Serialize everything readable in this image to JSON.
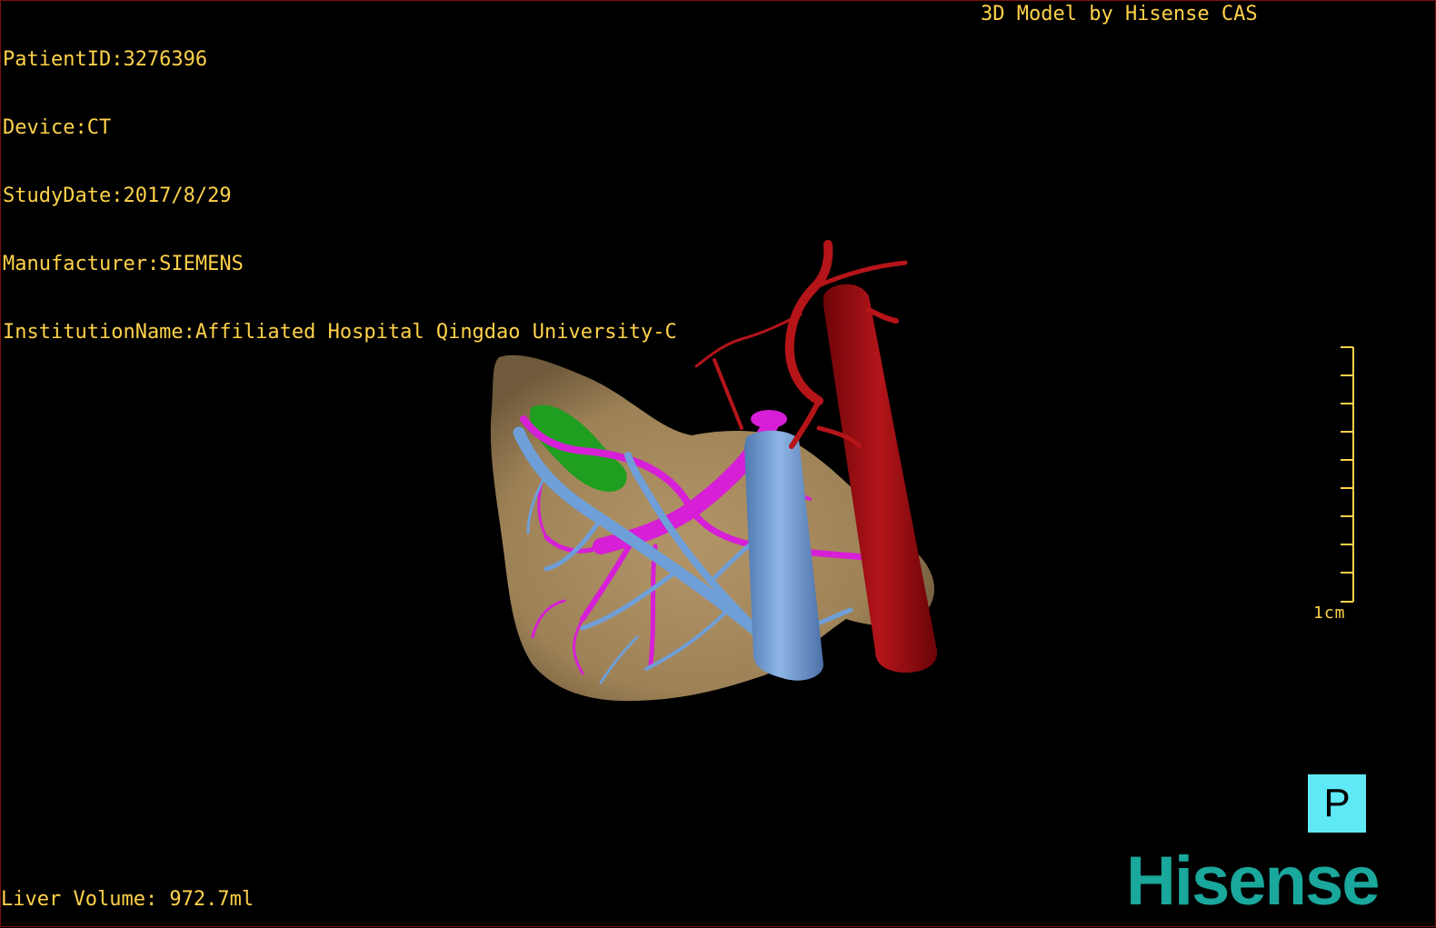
{
  "header": {
    "patient_id": "PatientID:3276396",
    "device": "Device:CT",
    "study_date": "StudyDate:2017/8/29",
    "manufacturer": "Manufacturer:SIEMENS",
    "institution": "InstitutionName:Affiliated Hospital Qingdao University-C"
  },
  "credit": "3D Model by Hisense CAS",
  "footer": {
    "liver_volume": "Liver Volume: 972.7ml"
  },
  "scale": {
    "label": "1cm"
  },
  "orientation": {
    "label": "P"
  },
  "brand": {
    "logo_text": "Hisense"
  },
  "model": {
    "structures": [
      {
        "name": "liver",
        "color": "#9e8257"
      },
      {
        "name": "gallbladder",
        "color": "#1f9e1f"
      },
      {
        "name": "portal-vein",
        "color": "#d61fd6"
      },
      {
        "name": "hepatic-vein",
        "color": "#6f9fd8"
      },
      {
        "name": "inferior-vena-cava",
        "color": "#6f9fd8"
      },
      {
        "name": "aorta",
        "color": "#a00f12"
      },
      {
        "name": "hepatic-artery",
        "color": "#b51419"
      }
    ]
  },
  "colors": {
    "overlay_text": "#ffd24a",
    "orientation_bg": "#5fe9f6",
    "logo": "#1aa79c",
    "background": "#000000"
  }
}
